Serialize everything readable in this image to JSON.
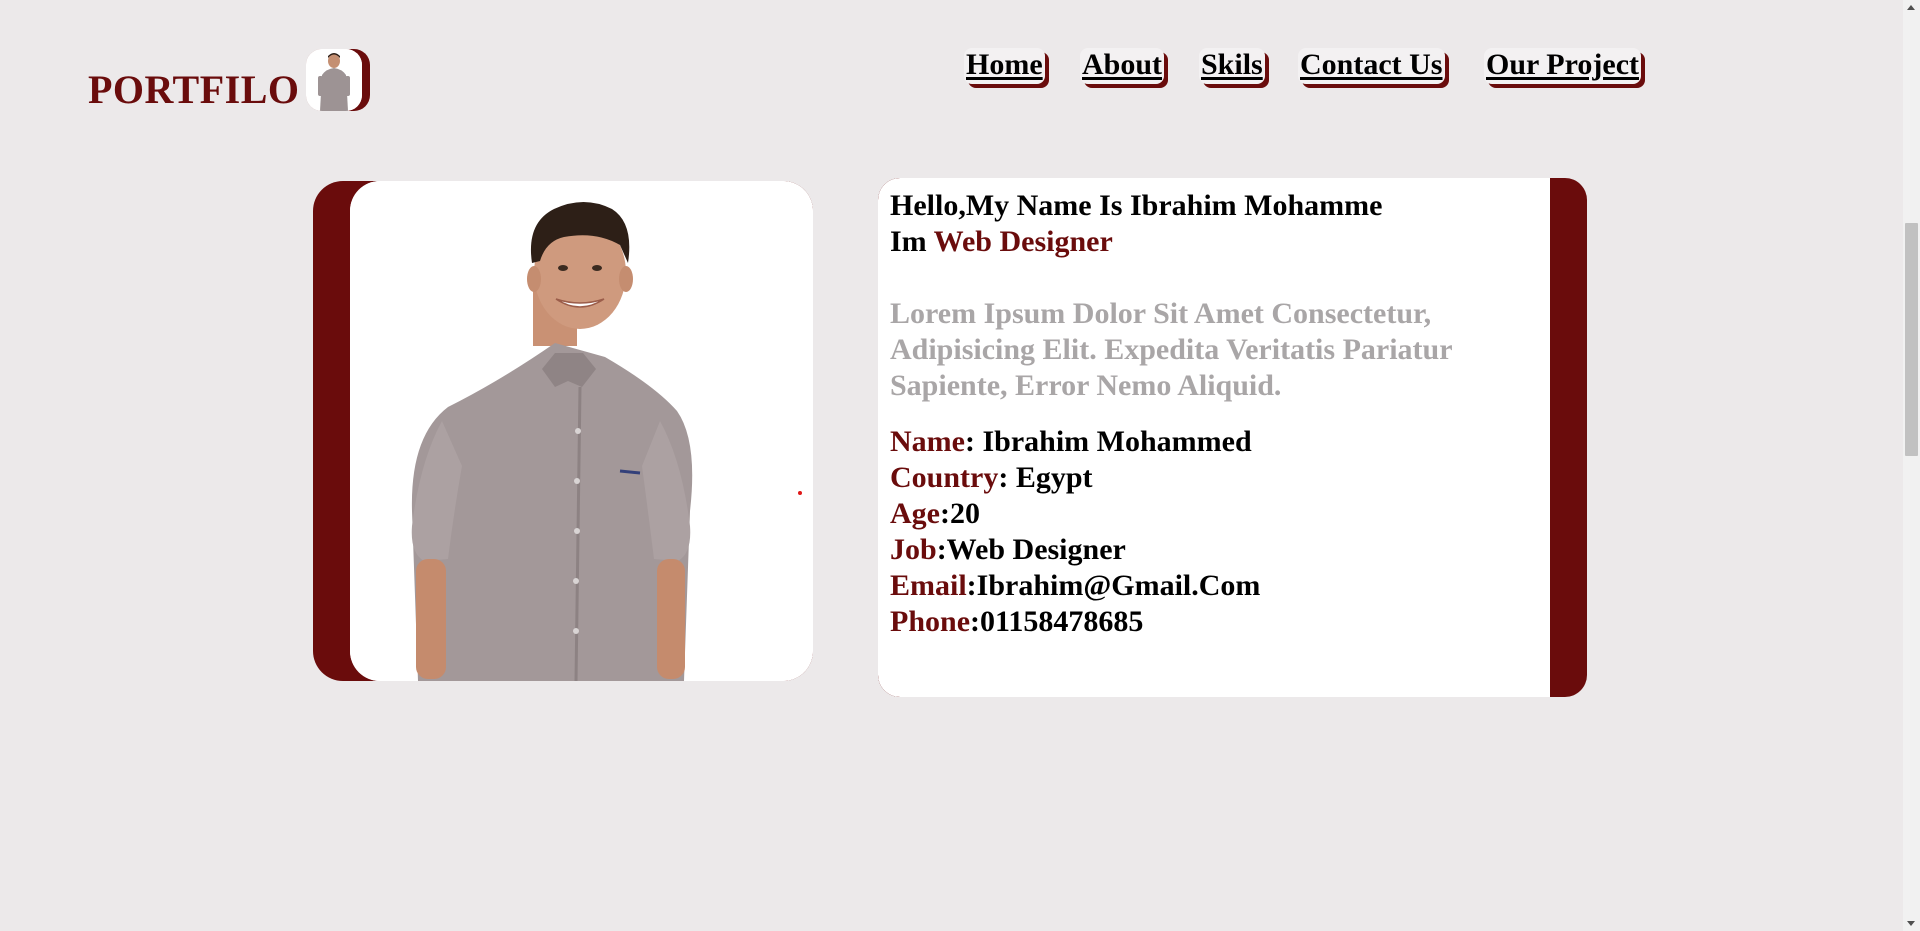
{
  "header": {
    "logo": "PORTFILO",
    "nav": [
      {
        "label": "Home"
      },
      {
        "label": "About"
      },
      {
        "label": "Skils"
      },
      {
        "label": "Contact Us"
      },
      {
        "label": "Our Project"
      }
    ]
  },
  "about": {
    "greeting_line1": "Hello,My Name Is Ibrahim Mohamme",
    "greeting_prefix": "Im ",
    "role": "Web Designer",
    "lorem": "Lorem Ipsum Dolor Sit Amet Consectetur, Adipisicing Elit. Expedita Veritatis Pariatur Sapiente, Error Nemo Aliquid.",
    "details": [
      {
        "label": "Name",
        "value": ": Ibrahim Mohammed"
      },
      {
        "label": "Country",
        "value": ": Egypt"
      },
      {
        "label": "Age",
        "value": ":20"
      },
      {
        "label": "Job",
        "value": ":Web Designer"
      },
      {
        "label": "Email",
        "value": ":Ibrahim@Gmail.Com"
      },
      {
        "label": "Phone",
        "value": ":01158478685"
      }
    ]
  },
  "colors": {
    "accent": "#6a0c0c",
    "background": "#ece9ea",
    "muted_text": "#a9a6a7"
  },
  "icons": {
    "scroll_up": "chevron-up-icon",
    "scroll_down": "chevron-down-icon"
  }
}
